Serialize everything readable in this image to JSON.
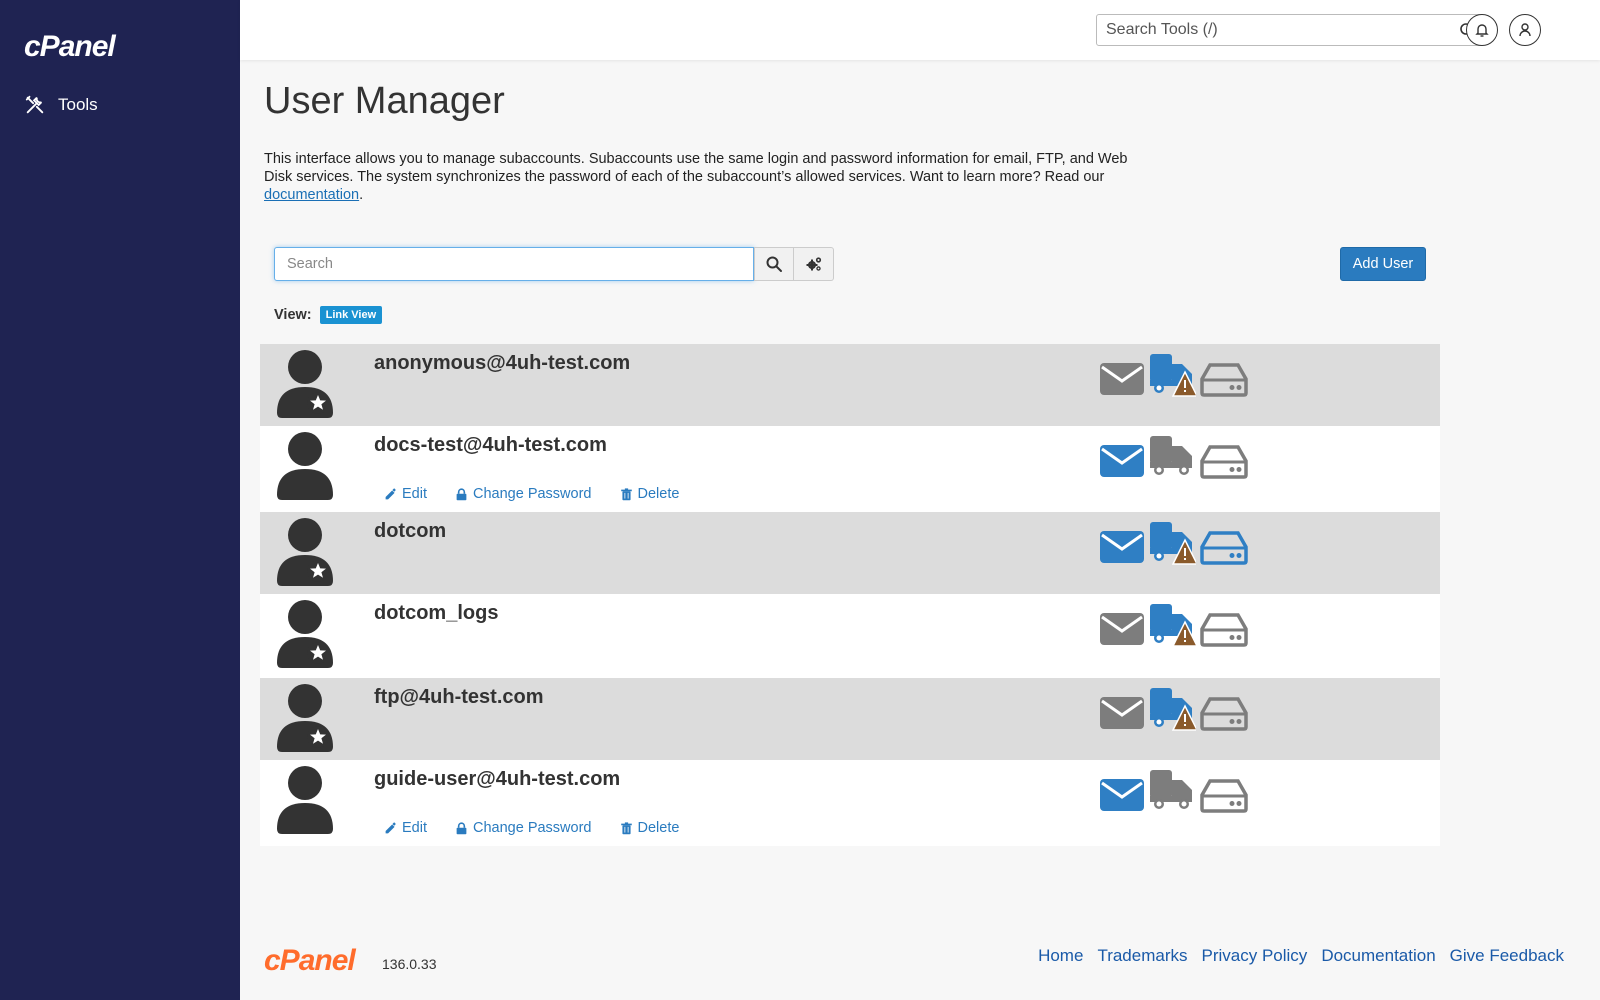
{
  "sidebar": {
    "logo": "cPanel",
    "nav": [
      {
        "label": "Tools",
        "icon": "tools-icon"
      }
    ]
  },
  "topbar": {
    "search_placeholder": "Search Tools (/)"
  },
  "page": {
    "title": "User Manager",
    "intro": "This interface allows you to manage subaccounts. Subaccounts use the same login and password information for email, FTP, and Web Disk services. The system synchronizes the password of each of the subaccount’s allowed services. Want to learn more? Read our ",
    "intro_link": "documentation",
    "intro_end": "."
  },
  "toolbar": {
    "search_placeholder": "Search",
    "add_user_label": "Add User",
    "view_label": "View:",
    "view_mode": "Link View"
  },
  "users": [
    {
      "name": "anonymous@4uh-test.com",
      "special": true,
      "email": "off",
      "ftp": "warn",
      "disk": "off",
      "shaded": true
    },
    {
      "name": "docs-test@4uh-test.com",
      "special": false,
      "email": "on",
      "ftp": "off",
      "disk": "off",
      "shaded": false,
      "actions": [
        "Edit",
        "Change Password",
        "Delete"
      ]
    },
    {
      "name": "dotcom",
      "special": true,
      "email": "on",
      "ftp": "warn",
      "disk": "on",
      "shaded": true
    },
    {
      "name": "dotcom_logs",
      "special": true,
      "email": "off",
      "ftp": "warn",
      "disk": "off",
      "shaded": false
    },
    {
      "name": "ftp@4uh-test.com",
      "special": true,
      "email": "off",
      "ftp": "warn",
      "disk": "off",
      "shaded": true
    },
    {
      "name": "guide-user@4uh-test.com",
      "special": false,
      "email": "on",
      "ftp": "off",
      "disk": "off",
      "shaded": false,
      "actions": [
        "Edit",
        "Change Password",
        "Delete"
      ]
    }
  ],
  "colors": {
    "sidebar": "#1f2352",
    "active_service": "#2f7fc4",
    "inactive_service": "#7d7d7d",
    "warning": "#8a5a2b",
    "brand_orange": "#ff6c2c",
    "link": "#2a7bbf"
  },
  "footer": {
    "logo": "cPanel",
    "version": "136.0.33",
    "links": [
      "Home",
      "Trademarks",
      "Privacy Policy",
      "Documentation",
      "Give Feedback"
    ]
  }
}
